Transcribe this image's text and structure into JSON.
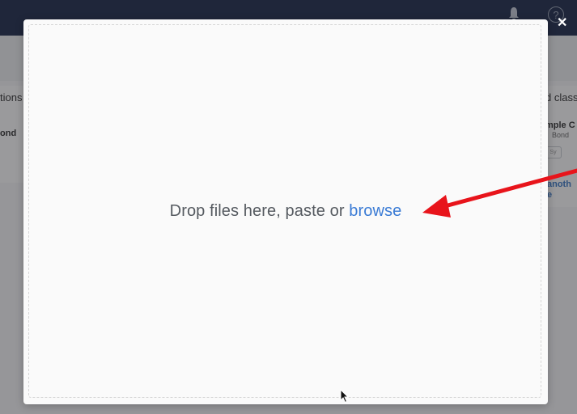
{
  "background": {
    "left_panel": {
      "title_fragment": "tions",
      "item_fragment": "ond"
    },
    "right_panel": {
      "title_fragment": "d class",
      "item_fragment": "mple C",
      "item_sub_fragment": "Bond",
      "button_fragment": "Sy",
      "link_fragment_1": "anoth",
      "link_fragment_2": "e"
    },
    "header": {
      "help_glyph": "?",
      "close_glyph": "✕"
    }
  },
  "modal": {
    "drop_text": "Drop files here, paste or ",
    "browse_label": "browse"
  },
  "annotation": {
    "arrow_color": "#e8141b"
  }
}
